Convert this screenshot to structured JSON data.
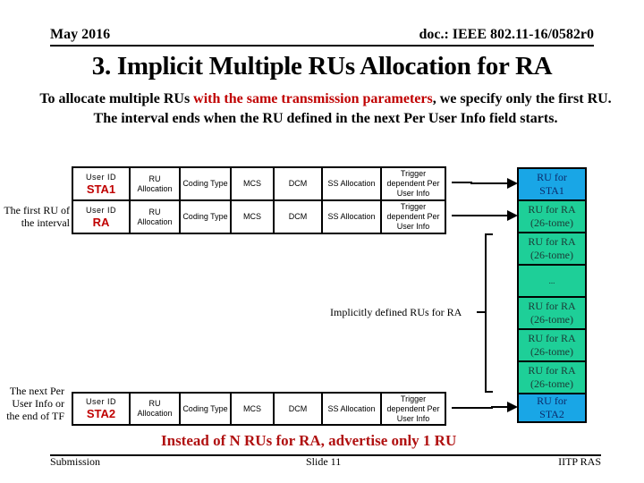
{
  "header": {
    "date": "May 2016",
    "doc": "doc.: IEEE 802.11-16/0582r0"
  },
  "title": "3. Implicit Multiple RUs Allocation for RA",
  "intro": {
    "part1": "To allocate multiple RUs ",
    "highlight": "with the same transmission parameters",
    "part2": ", we specify only the first RU. The interval ends when the RU defined in the next Per User Info field starts."
  },
  "side_labels": {
    "first_ru": "The first RU of the interval",
    "next_info": "The next Per User Info or the end of TF"
  },
  "fields": [
    {
      "user_id_label": "User ID",
      "user_id": "STA1",
      "ru_alloc": "RU Allocation",
      "coding": "Coding Type",
      "mcs": "MCS",
      "dcm": "DCM",
      "ss": "SS Allocation",
      "trigger": "Trigger dependent Per User Info"
    },
    {
      "user_id_label": "User ID",
      "user_id": "RA",
      "ru_alloc": "RU Allocation",
      "coding": "Coding Type",
      "mcs": "MCS",
      "dcm": "DCM",
      "ss": "SS Allocation",
      "trigger": "Trigger dependent Per User Info"
    },
    {
      "user_id_label": "User ID",
      "user_id": "STA2",
      "ru_alloc": "RU Allocation",
      "coding": "Coding Type",
      "mcs": "MCS",
      "dcm": "DCM",
      "ss": "SS Allocation",
      "trigger": "Trigger dependent Per User Info"
    }
  ],
  "ru_blocks": [
    {
      "line1": "RU for",
      "line2": "STA1",
      "type": "sta"
    },
    {
      "line1": "RU for RA",
      "line2": "(26-tome)",
      "type": "ra"
    },
    {
      "line1": "RU for RA",
      "line2": "(26-tome)",
      "type": "ra"
    },
    {
      "line1": "...",
      "line2": "",
      "type": "ra"
    },
    {
      "line1": "RU for RA",
      "line2": "(26-tome)",
      "type": "ra"
    },
    {
      "line1": "RU for RA",
      "line2": "(26-tome)",
      "type": "ra"
    },
    {
      "line1": "RU for RA",
      "line2": "(26-tome)",
      "type": "ra"
    },
    {
      "line1": "RU for",
      "line2": "STA2",
      "type": "sta"
    }
  ],
  "brace_label": "Implicitly defined RUs for RA",
  "bottom_note": "Instead of N RUs for RA, advertise only 1 RU",
  "footer": {
    "left": "Submission",
    "center": "Slide 11",
    "right": "IITP RAS"
  },
  "colors": {
    "highlight_red": "#c00000",
    "sta_blue": "#19a6e6",
    "ra_green": "#1ecf98"
  }
}
